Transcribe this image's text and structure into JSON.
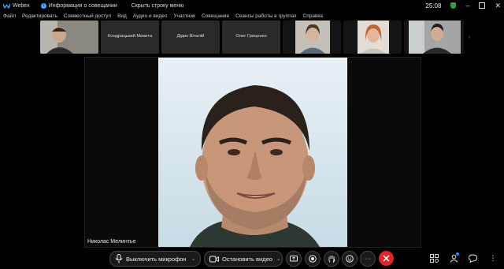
{
  "titlebar": {
    "app_name": "Webex",
    "meeting_info": "Информация о совещании",
    "hide_menu": "Скрыть строку меню",
    "clock": "25:08"
  },
  "menu": [
    "Файл",
    "Редактировать",
    "Совместный доступ",
    "Вид",
    "Аудио и видео",
    "Участник",
    "Совещание",
    "Сеансы работы в группах",
    "Справка"
  ],
  "participants": {
    "tile2": "Кондрацький Микита",
    "tile3": "Дідик Віталій",
    "tile4": "Олег Гриценко"
  },
  "stage": {
    "speaker_name": "Николас Мелинтье"
  },
  "controls": {
    "mute_label": "Выключить микрофон",
    "video_label": "Остановить видео",
    "more_label": "···"
  },
  "colors": {
    "end_call": "#e0232c",
    "accent": "#2d8cff"
  }
}
